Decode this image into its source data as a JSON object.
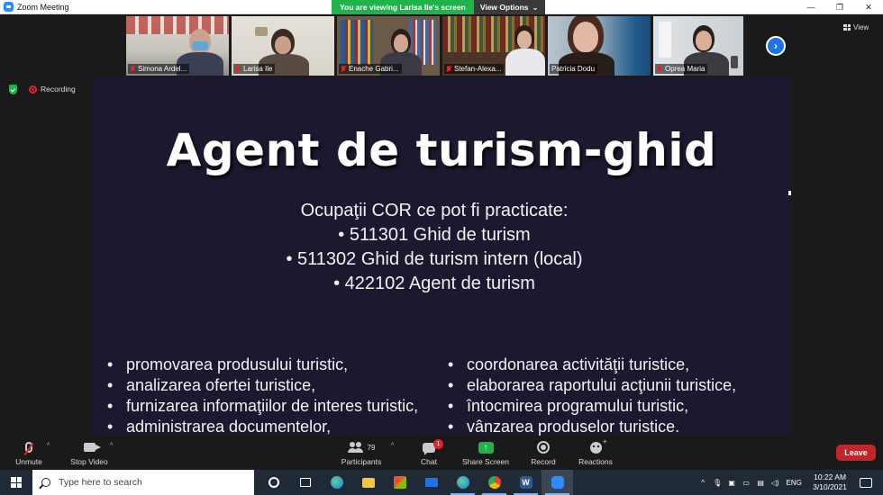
{
  "window": {
    "title": "Zoom Meeting",
    "controls": {
      "minimize": "—",
      "restore": "❐",
      "close": "✕"
    }
  },
  "share_banner": {
    "viewing_text": "You are viewing Larisa Ile's screen",
    "view_options_label": "View Options"
  },
  "participants_strip": {
    "tiles": [
      {
        "name": "Simona Ardel...",
        "muted": true
      },
      {
        "name": "Larisa Ile",
        "muted": true
      },
      {
        "name": "Enache Gabri...",
        "muted": true
      },
      {
        "name": "Stefan-Alexa...",
        "muted": true
      },
      {
        "name": "Patricia Dodu",
        "muted": false,
        "active_speaker": true
      },
      {
        "name": "Oprea Maria",
        "muted": true
      }
    ],
    "view_label": "View"
  },
  "meeting_status": {
    "recording_label": "Recording"
  },
  "slide": {
    "title": "Agent de turism-ghid",
    "subtitle_lines": [
      "Ocupaţii COR ce pot fi practicate:",
      "• 511301 Ghid de turism",
      "• 511302 Ghid de turism intern (local)",
      "• 422102 Agent de turism"
    ],
    "bullets_left": [
      "promovarea produsului turistic,",
      "analizarea ofertei turistice,",
      "furnizarea informaţiilor de interes turistic,",
      "administrarea documentelor,"
    ],
    "bullets_right": [
      "coordonarea activităţii turistice,",
      "elaborarea raportului acţiunii turistice,",
      "întocmirea programului turistic,",
      "vânzarea produselor turistice."
    ]
  },
  "toolbar": {
    "unmute_label": "Unmute",
    "stop_video_label": "Stop Video",
    "participants_label": "Participants",
    "participants_count": "79",
    "chat_label": "Chat",
    "chat_badge": "1",
    "share_screen_label": "Share Screen",
    "record_label": "Record",
    "reactions_label": "Reactions",
    "leave_label": "Leave"
  },
  "taskbar": {
    "search_placeholder": "Type here to search",
    "tray": {
      "language": "ENG",
      "time": "10:22 AM",
      "date": "3/10/2021"
    }
  },
  "colors": {
    "zoom_blue": "#2d8cff",
    "viewing_green": "#20b24b",
    "leave_red": "#c0262c",
    "slide_bg": "#1c1830",
    "taskbar_bg": "#1f2a36"
  }
}
